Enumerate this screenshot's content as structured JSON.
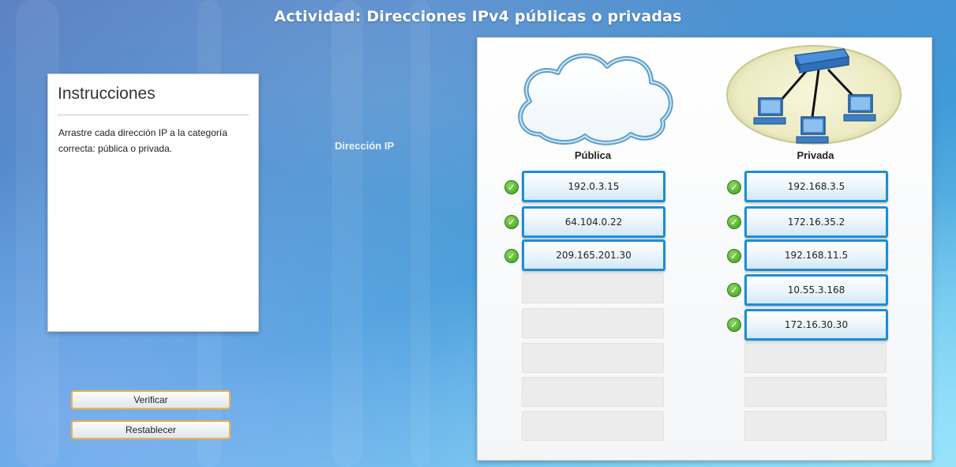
{
  "title": "Actividad: Direcciones IPv4 públicas o privadas",
  "instructions": {
    "heading": "Instrucciones",
    "text": "Arrastre cada dirección IP a la categoría correcta: pública o privada."
  },
  "buttons": {
    "verify": "Verificar",
    "reset": "Restablecer"
  },
  "ip_label": "Dirección IP",
  "categories": {
    "public": {
      "label": "Pública",
      "icon": "cloud-icon",
      "items": [
        "192.0.3.15",
        "64.104.0.22",
        "209.165.201.30"
      ],
      "empty_slots": 5
    },
    "private": {
      "label": "Privada",
      "icon": "network-switch-icon",
      "items": [
        "192.168.3.5",
        "172.16.35.2",
        "192.168.11.5",
        "10.55.3.168",
        "172.16.30.30"
      ],
      "empty_slots": 3
    }
  },
  "colors": {
    "chip_border": "#1a8fd6",
    "check": "#4caf2a",
    "button_border": "#f3b43a"
  }
}
